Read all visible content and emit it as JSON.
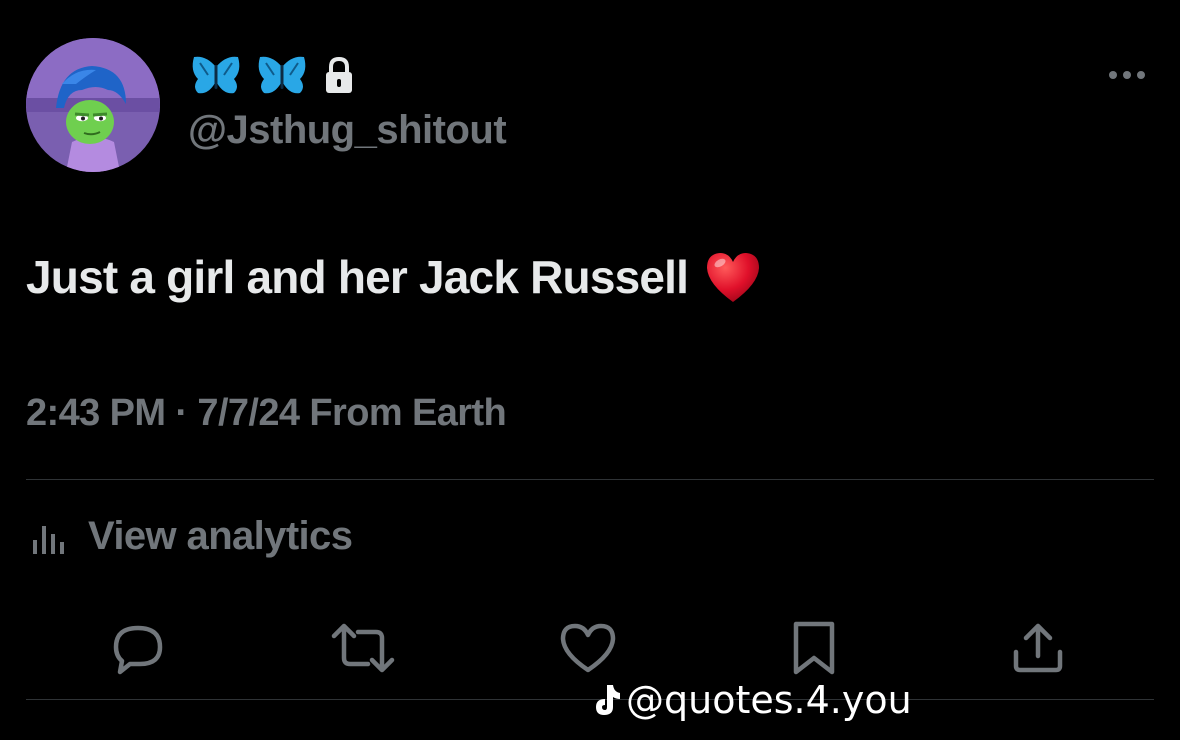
{
  "user": {
    "name_icons": [
      "butterfly-icon",
      "butterfly-icon",
      "lock-icon"
    ],
    "handle": "@Jsthug_shitout"
  },
  "tweet": {
    "text": "Just a girl and her Jack Russell",
    "emoji": "red-heart-emoji",
    "time": "2:43 PM",
    "separator": " · ",
    "date": "7/7/24",
    "source": " From Earth"
  },
  "analytics": {
    "label": "View analytics"
  },
  "actions": [
    "reply-icon",
    "retweet-icon",
    "like-icon",
    "bookmark-icon",
    "share-icon"
  ],
  "watermark": {
    "text": "@quotes.4.you"
  },
  "colors": {
    "background": "#000000",
    "text_primary": "#e7e9ea",
    "text_secondary": "#71767b",
    "divider": "#2f3336",
    "butterfly_blue": "#29a7e6",
    "heart_red": "#e0102a"
  }
}
